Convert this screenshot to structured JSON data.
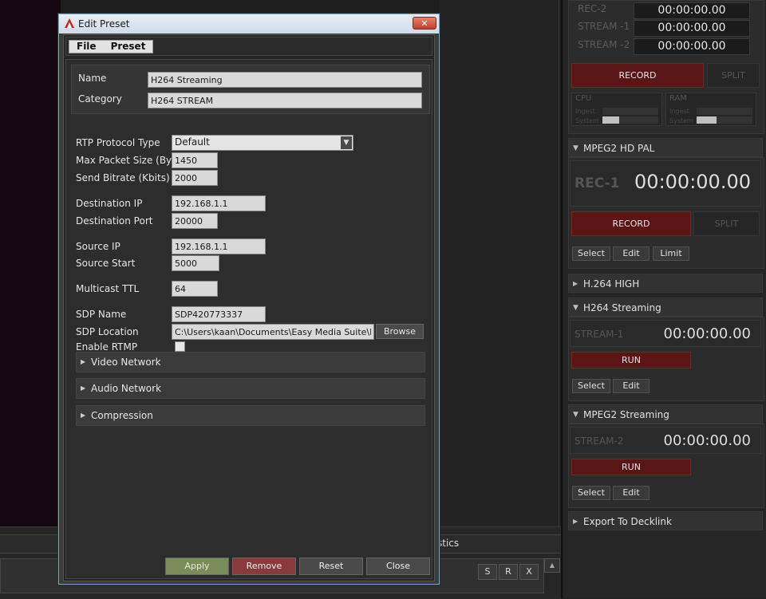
{
  "background": {
    "statistics_tab": "stics",
    "log_buttons": [
      "S",
      "R",
      "X"
    ]
  },
  "right_panel": {
    "top_group": {
      "rows": [
        {
          "label": "REC-2",
          "time": "00:00:00.00"
        },
        {
          "label": "STREAM -1",
          "time": "00:00:00.00"
        },
        {
          "label": "STREAM -2",
          "time": "00:00:00.00"
        }
      ],
      "record_label": "RECORD",
      "split_label": "SPLIT",
      "cpu": {
        "title": "CPU",
        "ingest": "Ingest",
        "system": "System",
        "system_level": 0.3
      },
      "ram": {
        "title": "RAM",
        "ingest": "Ingest",
        "system": "System",
        "system_level": 0.35
      }
    },
    "mpeg2_hd_pal": {
      "header": "MPEG2 HD PAL",
      "row_label": "REC-1",
      "time": "00:00:00.00",
      "record_label": "RECORD",
      "split_label": "SPLIT",
      "buttons": [
        "Select",
        "Edit",
        "Limit"
      ]
    },
    "h264_high": {
      "header": "H.264 HIGH"
    },
    "h264_streaming": {
      "header": "H264 Streaming",
      "row_label": "STREAM-1",
      "time": "00:00:00.00",
      "run_label": "RUN",
      "buttons": [
        "Select",
        "Edit"
      ]
    },
    "mpeg2_streaming": {
      "header": "MPEG2 Streaming",
      "row_label": "STREAM-2",
      "time": "00:00:00.00",
      "run_label": "RUN",
      "buttons": [
        "Select",
        "Edit"
      ]
    },
    "export": {
      "header": "Export To Decklink"
    }
  },
  "dialog": {
    "title": "Edit Preset",
    "close_glyph": "✕",
    "menu": [
      "File",
      "Preset"
    ],
    "fields": {
      "name": {
        "label": "Name",
        "value": "H264 Streaming"
      },
      "category": {
        "label": "Category",
        "value": "H264 STREAM"
      },
      "rtp_protocol": {
        "label": "RTP Protocol Type",
        "value": "Default"
      },
      "max_packet": {
        "label": "Max Packet Size (Byte)",
        "value": "1450"
      },
      "send_bitrate": {
        "label": "Send Bitrate (Kbits)",
        "value": "2000"
      },
      "dest_ip": {
        "label": "Destination IP",
        "value": "192.168.1.1"
      },
      "dest_port": {
        "label": "Destination Port",
        "value": "20000"
      },
      "source_ip": {
        "label": "Source IP",
        "value": "192.168.1.1"
      },
      "source_start": {
        "label": "Source Start",
        "value": "5000"
      },
      "multicast_ttl": {
        "label": "Multicast TTL",
        "value": "64"
      },
      "sdp_name": {
        "label": "SDP Name",
        "value": "SDP420773337"
      },
      "sdp_location": {
        "label": "SDP Location",
        "value": "C:\\Users\\kaan\\Documents\\Easy Media Suite\\Ir"
      },
      "enable_rtmp": {
        "label": "Enable RTMP",
        "checked": false
      }
    },
    "browse_label": "Browse",
    "sections": [
      "Video Network",
      "Audio Network",
      "Compression"
    ],
    "footer": {
      "apply": "Apply",
      "remove": "Remove",
      "reset": "Reset",
      "close": "Close"
    },
    "colors": {
      "apply": "#7a8c5a",
      "remove": "#8a3a3a",
      "neutral": "#4a4a4a"
    }
  }
}
